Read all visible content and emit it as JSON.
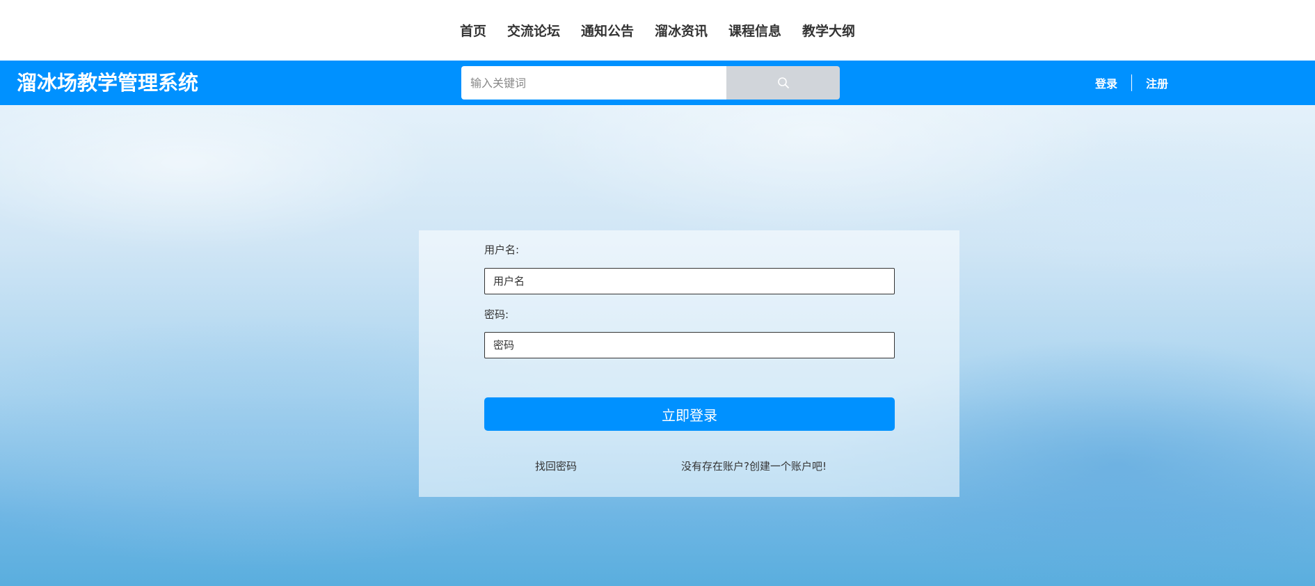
{
  "topnav": {
    "items": [
      "首页",
      "交流论坛",
      "通知公告",
      "溜冰资讯",
      "课程信息",
      "教学大纲"
    ]
  },
  "header": {
    "site_title": "溜冰场教学管理系统",
    "search": {
      "placeholder": "输入关键词",
      "value": "",
      "icon": "search-icon"
    },
    "auth": {
      "login_label": "登录",
      "register_label": "注册"
    }
  },
  "login": {
    "username_label": "用户名:",
    "username_placeholder": "用户名",
    "password_label": "密码:",
    "password_placeholder": "密码",
    "submit_label": "立即登录",
    "forgot_label": "找回密码",
    "register_prompt": "没有存在账户?创建一个账户吧!"
  },
  "colors": {
    "brand": "#0091ff",
    "search_button": "#d1d5da"
  }
}
